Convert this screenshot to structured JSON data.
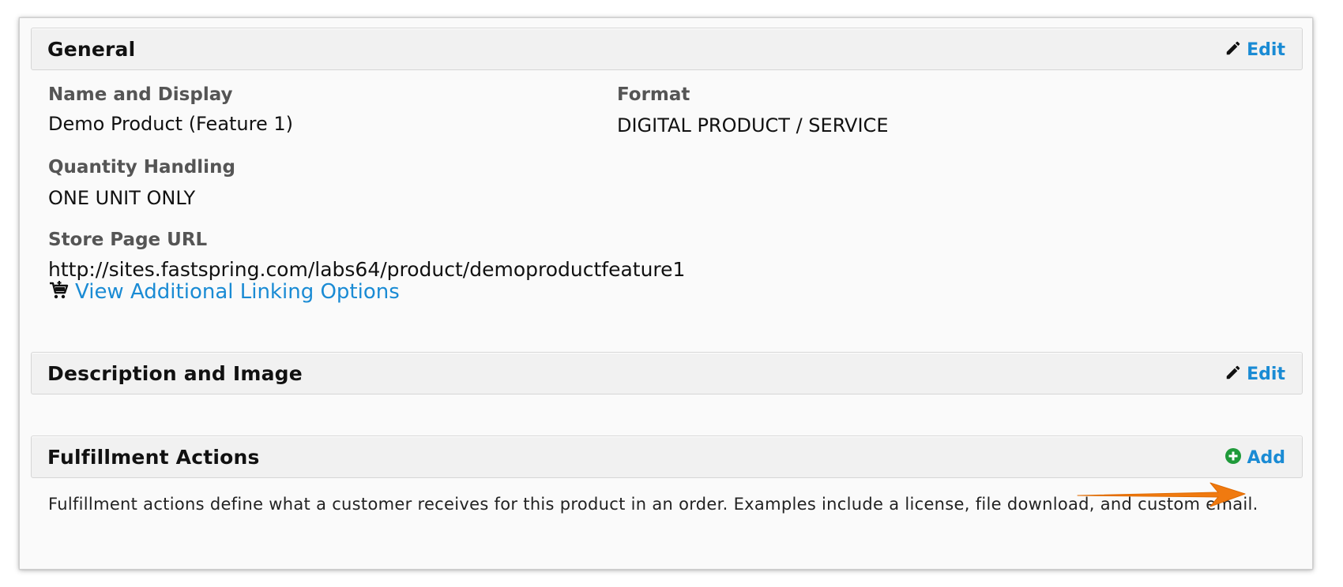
{
  "general": {
    "title": "General",
    "edit_label": "Edit",
    "name_display": {
      "label": "Name and Display",
      "value": "Demo Product (Feature 1)"
    },
    "format": {
      "label": "Format",
      "value": "DIGITAL PRODUCT / SERVICE"
    },
    "quantity": {
      "label": "Quantity Handling",
      "value": "ONE UNIT ONLY"
    },
    "store_url": {
      "label": "Store Page URL",
      "value": "http://sites.fastspring.com/labs64/product/demoproductfeature1",
      "link_label": "View Additional Linking Options",
      "link_icon": "shopping-cart-icon"
    }
  },
  "description": {
    "title": "Description and Image",
    "edit_label": "Edit"
  },
  "fulfillment": {
    "title": "Fulfillment Actions",
    "add_label": "Add",
    "help": "Fulfillment actions define what a customer receives for this product in an order. Examples include a license, file download, and custom email."
  },
  "icons": {
    "edit": "pencil-icon",
    "add": "plus-circle-icon",
    "annotation": "orange-arrow-icon"
  },
  "colors": {
    "link": "#1a8bd4",
    "add_icon": "#1f9a3a",
    "arrow": "#f07a10"
  }
}
